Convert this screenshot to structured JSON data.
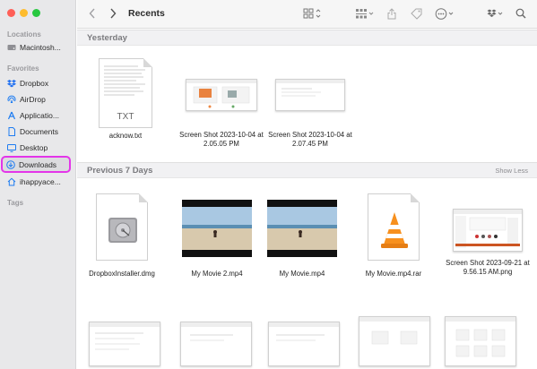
{
  "sidebar": {
    "sections": {
      "locations": "Locations",
      "favorites": "Favorites",
      "tags": "Tags"
    },
    "locations": [
      {
        "label": "Macintosh...",
        "icon": "hard-drive-icon"
      }
    ],
    "favorites": [
      {
        "label": "Dropbox",
        "icon": "dropbox-icon"
      },
      {
        "label": "AirDrop",
        "icon": "airdrop-icon"
      },
      {
        "label": "Applicatio...",
        "icon": "applications-icon"
      },
      {
        "label": "Documents",
        "icon": "document-icon"
      },
      {
        "label": "Desktop",
        "icon": "desktop-icon"
      },
      {
        "label": "Downloads",
        "icon": "downloads-icon"
      },
      {
        "label": "ihappyace...",
        "icon": "home-icon"
      }
    ]
  },
  "toolbar": {
    "title": "Recents",
    "icons": [
      "back-icon",
      "forward-icon",
      "grid-view-icon",
      "group-icon",
      "share-icon",
      "tag-icon",
      "more-icon",
      "dropbox-icon",
      "search-icon"
    ]
  },
  "groups": [
    {
      "title": "Yesterday",
      "files": [
        {
          "name": "acknow.txt",
          "type": "txt",
          "badge": "TXT"
        },
        {
          "name": "Screen Shot 2023-10-04 at 2.05.05 PM",
          "type": "screenshot"
        },
        {
          "name": "Screen Shot 2023-10-04 at 2.07.45 PM",
          "type": "screenshot"
        }
      ]
    },
    {
      "title": "Previous 7 Days",
      "action": "Show Less",
      "files": [
        {
          "name": "DropboxInstaller.dmg",
          "type": "dmg"
        },
        {
          "name": "My Movie 2.mp4",
          "type": "video"
        },
        {
          "name": "My Movie.mp4",
          "type": "video"
        },
        {
          "name": "My Movie.mp4.rar",
          "type": "rar"
        },
        {
          "name": "Screen Shot 2023-09-21 at 9.56.15 AM.png",
          "type": "screenshot"
        }
      ]
    }
  ],
  "colors": {
    "accent": "#1a73e8",
    "highlight": "#e335e9",
    "close": "#ff5f57",
    "minimize": "#febc2e",
    "zoom": "#28c840"
  }
}
